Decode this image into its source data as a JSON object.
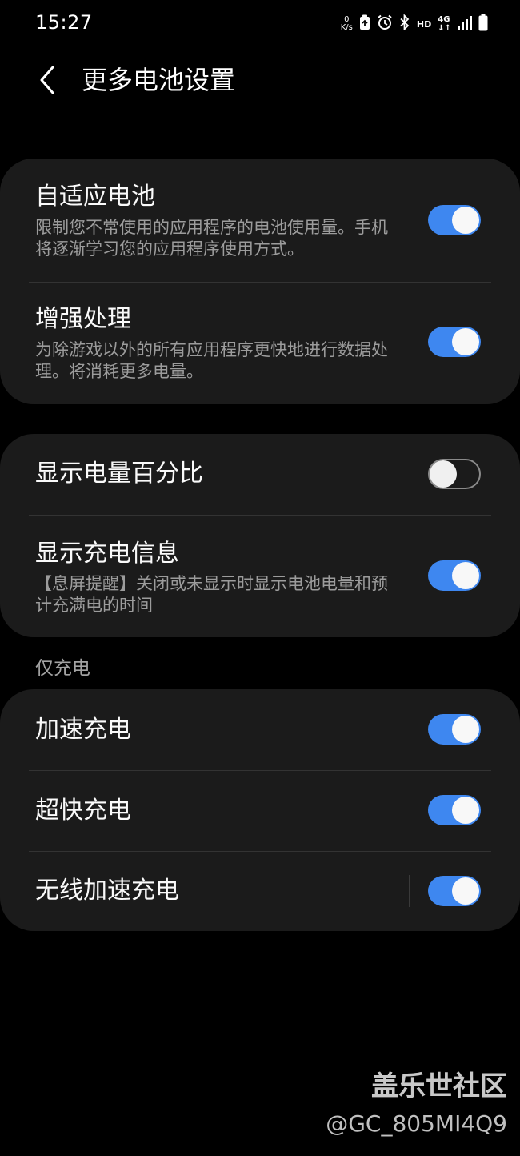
{
  "status_bar": {
    "time": "15:27",
    "net_speed_value": "0",
    "net_speed_unit": "K/s",
    "hd": "HD",
    "network": "4G",
    "network_arrows": "↓↑"
  },
  "header": {
    "title": "更多电池设置"
  },
  "card1": {
    "adaptive": {
      "title": "自适应电池",
      "desc": "限制您不常使用的应用程序的电池使用量。手机将逐渐学习您的应用程序使用方式。",
      "enabled": true
    },
    "enhanced": {
      "title": "增强处理",
      "desc": "为除游戏以外的所有应用程序更快地进行数据处理。将消耗更多电量。",
      "enabled": true
    }
  },
  "card2": {
    "percentage": {
      "title": "显示电量百分比",
      "enabled": false
    },
    "charging_info": {
      "title": "显示充电信息",
      "desc": "【息屏提醒】关闭或未显示时显示电池电量和预计充满电的时间",
      "enabled": true
    }
  },
  "section": {
    "charging_only": "仅充电"
  },
  "card3": {
    "fast": {
      "title": "加速充电",
      "enabled": true
    },
    "super_fast": {
      "title": "超快充电",
      "enabled": true
    },
    "wireless": {
      "title": "无线加速充电",
      "enabled": true
    }
  },
  "watermark": {
    "line1": "盖乐世社区",
    "line2": "@GC_805MI4Q9"
  },
  "colors": {
    "background": "#000000",
    "card": "#1b1b1b",
    "toggle_on": "#3e87f0",
    "secondary_text": "#9c9c9c"
  }
}
